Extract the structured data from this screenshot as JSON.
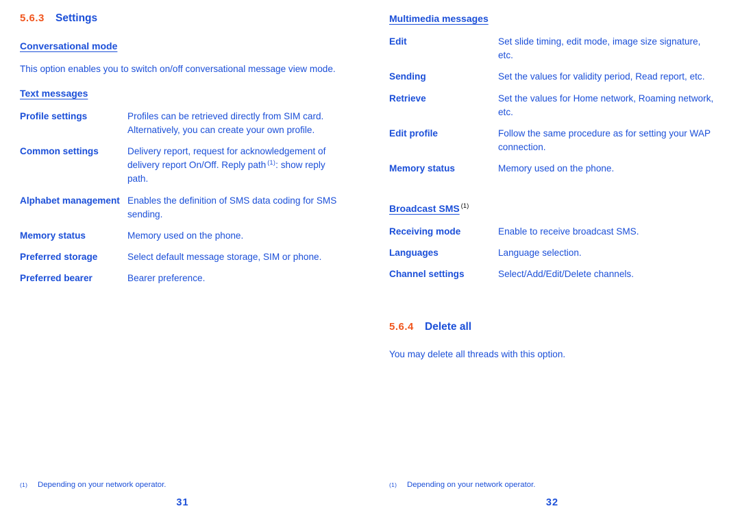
{
  "colors": {
    "section_number": "#F0561E",
    "text_blue": "#1B4FD8",
    "background": "#FFFFFF"
  },
  "left_page": {
    "section": {
      "number": "5.6.3",
      "title": "Settings"
    },
    "conversational_mode": {
      "heading": "Conversational mode",
      "paragraph": "This option enables you to switch on/off conversational message view mode."
    },
    "text_messages": {
      "heading": "Text messages",
      "rows": [
        {
          "label": "Profile settings",
          "description": "Profiles can be retrieved directly from SIM card. Alternatively, you can create your own profile.",
          "footnote": ""
        },
        {
          "label": "Common settings",
          "description_part1": "Delivery report, request for acknowledgement of delivery report On/Off. Reply path",
          "footnote": "(1)",
          "description_part2": ": show reply path."
        },
        {
          "label": "Alphabet management",
          "description": "Enables the definition of SMS data coding for SMS sending.",
          "footnote": ""
        },
        {
          "label": "Memory status",
          "description": "Memory used on the phone.",
          "footnote": ""
        },
        {
          "label": "Preferred storage",
          "description": "Select default message storage, SIM or phone.",
          "footnote": ""
        },
        {
          "label": "Preferred bearer",
          "description": "Bearer preference.",
          "footnote": ""
        }
      ]
    },
    "footer": {
      "footnote_mark": "(1)",
      "footnote_text": "Depending on your network operator.",
      "page_number": "31"
    }
  },
  "right_page": {
    "multimedia_messages": {
      "heading": "Multimedia messages",
      "rows": [
        {
          "label": "Edit",
          "description": "Set slide timing, edit mode, image size signature, etc."
        },
        {
          "label": "Sending",
          "description": "Set the values for validity period, Read report, etc."
        },
        {
          "label": "Retrieve",
          "description": "Set the values for Home network, Roaming network, etc."
        },
        {
          "label": "Edit profile",
          "description": "Follow the same procedure as for setting your WAP connection."
        },
        {
          "label": "Memory status",
          "description": "Memory used on the phone."
        }
      ]
    },
    "broadcast_sms": {
      "heading": "Broadcast SMS",
      "heading_footnote": "(1)",
      "rows": [
        {
          "label": "Receiving mode",
          "description": "Enable to receive broadcast SMS."
        },
        {
          "label": "Languages",
          "description": "Language selection."
        },
        {
          "label": "Channel settings",
          "description": "Select/Add/Edit/Delete channels."
        }
      ]
    },
    "delete_all": {
      "section": {
        "number": "5.6.4",
        "title": "Delete all"
      },
      "paragraph": "You may delete all threads with this option."
    },
    "footer": {
      "footnote_mark": "(1)",
      "footnote_text": "Depending on your network operator.",
      "page_number": "32"
    }
  }
}
